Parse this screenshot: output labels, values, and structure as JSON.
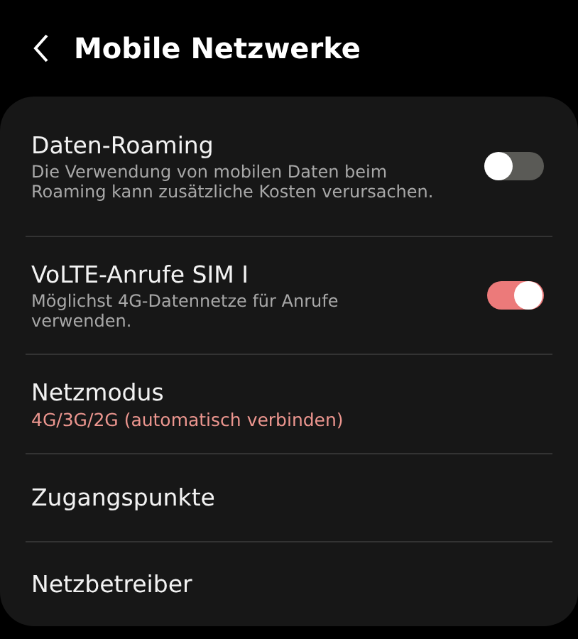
{
  "header": {
    "title": "Mobile Netzwerke"
  },
  "items": [
    {
      "kind": "toggle",
      "title": "Daten-Roaming",
      "subtitle": "Die Verwendung von mobilen Daten beim Roaming kann zusätzliche Kosten verursachen.",
      "on": false
    },
    {
      "kind": "toggle",
      "title": "VoLTE-Anrufe SIM I",
      "subtitle": "Möglichst 4G-Datennetze für Anrufe verwenden.",
      "on": true
    },
    {
      "kind": "value",
      "title": "Netzmodus",
      "value": "4G/3G/2G (automatisch verbinden)"
    },
    {
      "kind": "plain",
      "title": "Zugangspunkte"
    },
    {
      "kind": "plain",
      "title": "Netzbetreiber"
    }
  ]
}
